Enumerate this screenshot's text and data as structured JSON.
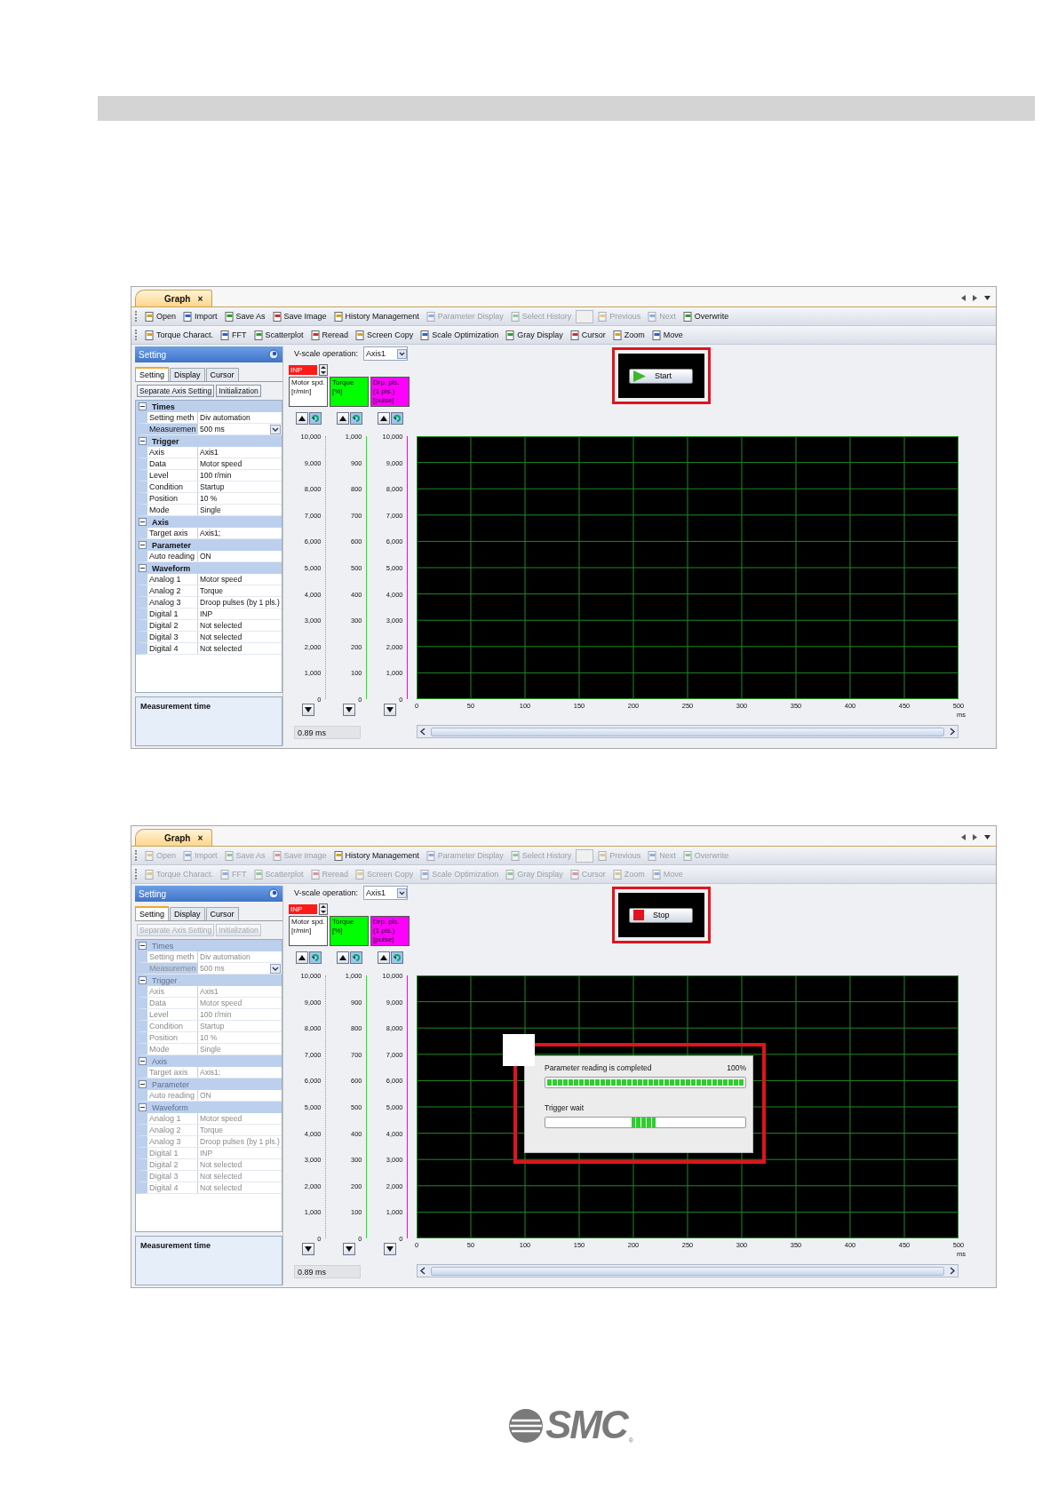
{
  "screens": [
    {
      "tab": {
        "label": "Graph",
        "close": "×"
      },
      "toolbars": [
        [
          {
            "kind": "button",
            "label": "Open",
            "disabled": false
          },
          {
            "kind": "button",
            "label": "Import",
            "disabled": false
          },
          {
            "kind": "button",
            "label": "Save As",
            "disabled": false
          },
          {
            "kind": "button",
            "label": "Save Image",
            "disabled": false
          },
          {
            "kind": "button",
            "label": "History Management",
            "disabled": false
          },
          {
            "kind": "button",
            "label": "Parameter Display",
            "disabled": true
          },
          {
            "kind": "button",
            "label": "Select History",
            "disabled": true
          },
          {
            "kind": "field",
            "disabled": true
          },
          {
            "kind": "button",
            "label": "Previous",
            "disabled": true
          },
          {
            "kind": "button",
            "label": "Next",
            "disabled": true
          },
          {
            "kind": "button",
            "label": "Overwrite",
            "disabled": false
          }
        ],
        [
          {
            "kind": "button",
            "label": "Torque Charact.",
            "disabled": false
          },
          {
            "kind": "button",
            "label": "FFT",
            "disabled": false
          },
          {
            "kind": "button",
            "label": "Scatterplot",
            "disabled": false
          },
          {
            "kind": "button",
            "label": "Reread",
            "disabled": false
          },
          {
            "kind": "button",
            "label": "Screen Copy",
            "disabled": false
          },
          {
            "kind": "button",
            "label": "Scale Optimization",
            "disabled": false
          },
          {
            "kind": "button",
            "label": "Gray Display",
            "disabled": false
          },
          {
            "kind": "button",
            "label": "Cursor",
            "disabled": false
          },
          {
            "kind": "button",
            "label": "Zoom",
            "disabled": false
          },
          {
            "kind": "button",
            "label": "Move",
            "disabled": false
          }
        ]
      ],
      "panel": {
        "title": "Setting",
        "tabs": [
          {
            "label": "Setting",
            "selected": true
          },
          {
            "label": "Display",
            "selected": false
          },
          {
            "label": "Cursor",
            "selected": false
          }
        ],
        "buttons": [
          {
            "label": "Separate Axis Setting",
            "disabled": false
          },
          {
            "label": "Initialization",
            "disabled": false
          }
        ],
        "groups": [
          {
            "label": "Times",
            "disabled": false,
            "expanded": true,
            "rows": [
              {
                "name": "Setting meth",
                "value": "Div automation",
                "kind": "text",
                "selected": false
              },
              {
                "name": "Measuremen",
                "value": "500 ms",
                "kind": "dropdown",
                "selected": true
              }
            ]
          },
          {
            "label": "Trigger",
            "disabled": false,
            "expanded": true,
            "rows": [
              {
                "name": "Axis",
                "value": "Axis1",
                "kind": "text",
                "selected": false
              },
              {
                "name": "Data",
                "value": "Motor speed",
                "kind": "text",
                "selected": false
              },
              {
                "name": "Level",
                "value": "100 r/min",
                "kind": "text",
                "selected": false
              },
              {
                "name": "Condition",
                "value": "Startup",
                "kind": "text",
                "selected": false
              },
              {
                "name": "Position",
                "value": "10 %",
                "kind": "text",
                "selected": false
              },
              {
                "name": "Mode",
                "value": "Single",
                "kind": "text",
                "selected": false
              }
            ]
          },
          {
            "label": "Axis",
            "disabled": false,
            "expanded": true,
            "rows": [
              {
                "name": "Target axis",
                "value": "Axis1;",
                "kind": "text",
                "selected": false
              }
            ]
          },
          {
            "label": "Parameter",
            "disabled": false,
            "expanded": true,
            "rows": [
              {
                "name": "Auto reading",
                "value": "ON",
                "kind": "text",
                "selected": false
              }
            ]
          },
          {
            "label": "Waveform",
            "disabled": false,
            "expanded": true,
            "rows": [
              {
                "name": "Analog 1",
                "value": "Motor speed",
                "kind": "text",
                "selected": false
              },
              {
                "name": "Analog 2",
                "value": "Torque",
                "kind": "text",
                "selected": false
              },
              {
                "name": "Analog 3",
                "value": "Droop pulses (by 1 pls.)",
                "kind": "text",
                "selected": false
              },
              {
                "name": "Digital 1",
                "value": "INP",
                "kind": "text",
                "selected": false
              },
              {
                "name": "Digital 2",
                "value": "Not selected",
                "kind": "text",
                "selected": false
              },
              {
                "name": "Digital 3",
                "value": "Not selected",
                "kind": "text",
                "selected": false
              },
              {
                "name": "Digital 4",
                "value": "Not selected",
                "kind": "text",
                "selected": false
              }
            ]
          }
        ],
        "description_title": "Measurement time"
      },
      "vscale": {
        "label": "V-scale operation:",
        "value": "Axis1"
      },
      "inp": "INP",
      "channels": [
        {
          "label": "Motor spd.\n[r/min]",
          "color": "#ffffff",
          "ticks": [
            "10,000",
            "9,000",
            "8,000",
            "7,000",
            "6,000",
            "5,000",
            "4,000",
            "3,000",
            "2,000",
            "1,000",
            "0"
          ]
        },
        {
          "label": "Torque\n[%]",
          "color": "#00ff00",
          "ticks": [
            "1,000",
            "900",
            "800",
            "700",
            "600",
            "500",
            "400",
            "300",
            "200",
            "100",
            "0"
          ]
        },
        {
          "label": "Drp. pls.\n(1 pls.)\n[pulse]",
          "color": "#ff00ff",
          "ticks": [
            "10,000",
            "9,000",
            "8,000",
            "7,000",
            "6,000",
            "5,000",
            "4,000",
            "3,000",
            "2,000",
            "1,000",
            "0"
          ]
        }
      ],
      "time_reading": "0.89 ms",
      "run_button": {
        "kind": "start",
        "label": "Start"
      },
      "x_ticks": [
        "0",
        "50",
        "100",
        "150",
        "200",
        "250",
        "300",
        "350",
        "400",
        "450",
        "500"
      ],
      "x_unit": "ms"
    },
    {
      "tab": {
        "label": "Graph",
        "close": "×"
      },
      "toolbars": [
        [
          {
            "kind": "button",
            "label": "Open",
            "disabled": true
          },
          {
            "kind": "button",
            "label": "Import",
            "disabled": true
          },
          {
            "kind": "button",
            "label": "Save As",
            "disabled": true
          },
          {
            "kind": "button",
            "label": "Save Image",
            "disabled": true
          },
          {
            "kind": "button",
            "label": "History Management",
            "disabled": false
          },
          {
            "kind": "button",
            "label": "Parameter Display",
            "disabled": true
          },
          {
            "kind": "button",
            "label": "Select History",
            "disabled": true
          },
          {
            "kind": "field",
            "disabled": true
          },
          {
            "kind": "button",
            "label": "Previous",
            "disabled": true
          },
          {
            "kind": "button",
            "label": "Next",
            "disabled": true
          },
          {
            "kind": "button",
            "label": "Overwrite",
            "disabled": true
          }
        ],
        [
          {
            "kind": "button",
            "label": "Torque Charact.",
            "disabled": true
          },
          {
            "kind": "button",
            "label": "FFT",
            "disabled": true
          },
          {
            "kind": "button",
            "label": "Scatterplot",
            "disabled": true
          },
          {
            "kind": "button",
            "label": "Reread",
            "disabled": true
          },
          {
            "kind": "button",
            "label": "Screen Copy",
            "disabled": true
          },
          {
            "kind": "button",
            "label": "Scale Optimization",
            "disabled": true
          },
          {
            "kind": "button",
            "label": "Gray Display",
            "disabled": true
          },
          {
            "kind": "button",
            "label": "Cursor",
            "disabled": true
          },
          {
            "kind": "button",
            "label": "Zoom",
            "disabled": true
          },
          {
            "kind": "button",
            "label": "Move",
            "disabled": true
          }
        ]
      ],
      "panel": {
        "title": "Setting",
        "tabs": [
          {
            "label": "Setting",
            "selected": true
          },
          {
            "label": "Display",
            "selected": false
          },
          {
            "label": "Cursor",
            "selected": false
          }
        ],
        "buttons": [
          {
            "label": "Separate Axis Setting",
            "disabled": true
          },
          {
            "label": "Initialization",
            "disabled": true
          }
        ],
        "groups": [
          {
            "label": "Times",
            "disabled": true,
            "expanded": true,
            "rows": [
              {
                "name": "Setting meth",
                "value": "Div automation",
                "kind": "text",
                "selected": false
              },
              {
                "name": "Measuremen",
                "value": "500 ms",
                "kind": "dropdown",
                "selected": true
              }
            ]
          },
          {
            "label": "Trigger",
            "disabled": true,
            "expanded": true,
            "rows": [
              {
                "name": "Axis",
                "value": "Axis1",
                "kind": "text",
                "selected": false
              },
              {
                "name": "Data",
                "value": "Motor speed",
                "kind": "text",
                "selected": false
              },
              {
                "name": "Level",
                "value": "100 r/min",
                "kind": "text",
                "selected": false
              },
              {
                "name": "Condition",
                "value": "Startup",
                "kind": "text",
                "selected": false
              },
              {
                "name": "Position",
                "value": "10 %",
                "kind": "text",
                "selected": false
              },
              {
                "name": "Mode",
                "value": "Single",
                "kind": "text",
                "selected": false
              }
            ]
          },
          {
            "label": "Axis",
            "disabled": true,
            "expanded": true,
            "rows": [
              {
                "name": "Target axis",
                "value": "Axis1;",
                "kind": "text",
                "selected": false
              }
            ]
          },
          {
            "label": "Parameter",
            "disabled": true,
            "expanded": true,
            "rows": [
              {
                "name": "Auto reading",
                "value": "ON",
                "kind": "text",
                "selected": false
              }
            ]
          },
          {
            "label": "Waveform",
            "disabled": true,
            "expanded": true,
            "rows": [
              {
                "name": "Analog 1",
                "value": "Motor speed",
                "kind": "text",
                "selected": false
              },
              {
                "name": "Analog 2",
                "value": "Torque",
                "kind": "text",
                "selected": false
              },
              {
                "name": "Analog 3",
                "value": "Droop pulses (by 1 pls.)",
                "kind": "text",
                "selected": false
              },
              {
                "name": "Digital 1",
                "value": "INP",
                "kind": "text",
                "selected": false
              },
              {
                "name": "Digital 2",
                "value": "Not selected",
                "kind": "text",
                "selected": false
              },
              {
                "name": "Digital 3",
                "value": "Not selected",
                "kind": "text",
                "selected": false
              },
              {
                "name": "Digital 4",
                "value": "Not selected",
                "kind": "text",
                "selected": false
              }
            ]
          }
        ],
        "description_title": "Measurement time"
      },
      "vscale": {
        "label": "V-scale operation:",
        "value": "Axis1"
      },
      "inp": "INP",
      "channels": [
        {
          "label": "Motor spd.\n[r/min]",
          "color": "#ffffff",
          "ticks": [
            "10,000",
            "9,000",
            "8,000",
            "7,000",
            "6,000",
            "5,000",
            "4,000",
            "3,000",
            "2,000",
            "1,000",
            "0"
          ]
        },
        {
          "label": "Torque\n[%]",
          "color": "#00ff00",
          "ticks": [
            "1,000",
            "900",
            "800",
            "700",
            "600",
            "500",
            "400",
            "300",
            "200",
            "100",
            "0"
          ]
        },
        {
          "label": "Drp. pls.\n(1 pls.)\n[pulse]",
          "color": "#ff00ff",
          "ticks": [
            "10,000",
            "9,000",
            "8,000",
            "7,000",
            "6,000",
            "5,000",
            "4,000",
            "3,000",
            "2,000",
            "1,000",
            "0"
          ]
        }
      ],
      "time_reading": "0.89 ms",
      "run_button": {
        "kind": "stop",
        "label": "Stop"
      },
      "x_ticks": [
        "0",
        "50",
        "100",
        "150",
        "200",
        "250",
        "300",
        "350",
        "400",
        "450",
        "500"
      ],
      "x_unit": "ms",
      "dialog": {
        "message": "Parameter reading is completed",
        "percent": "100%",
        "level": 1,
        "status": "Trigger wait"
      }
    }
  ],
  "logo": {
    "text": "SMC",
    "mark": "®"
  }
}
